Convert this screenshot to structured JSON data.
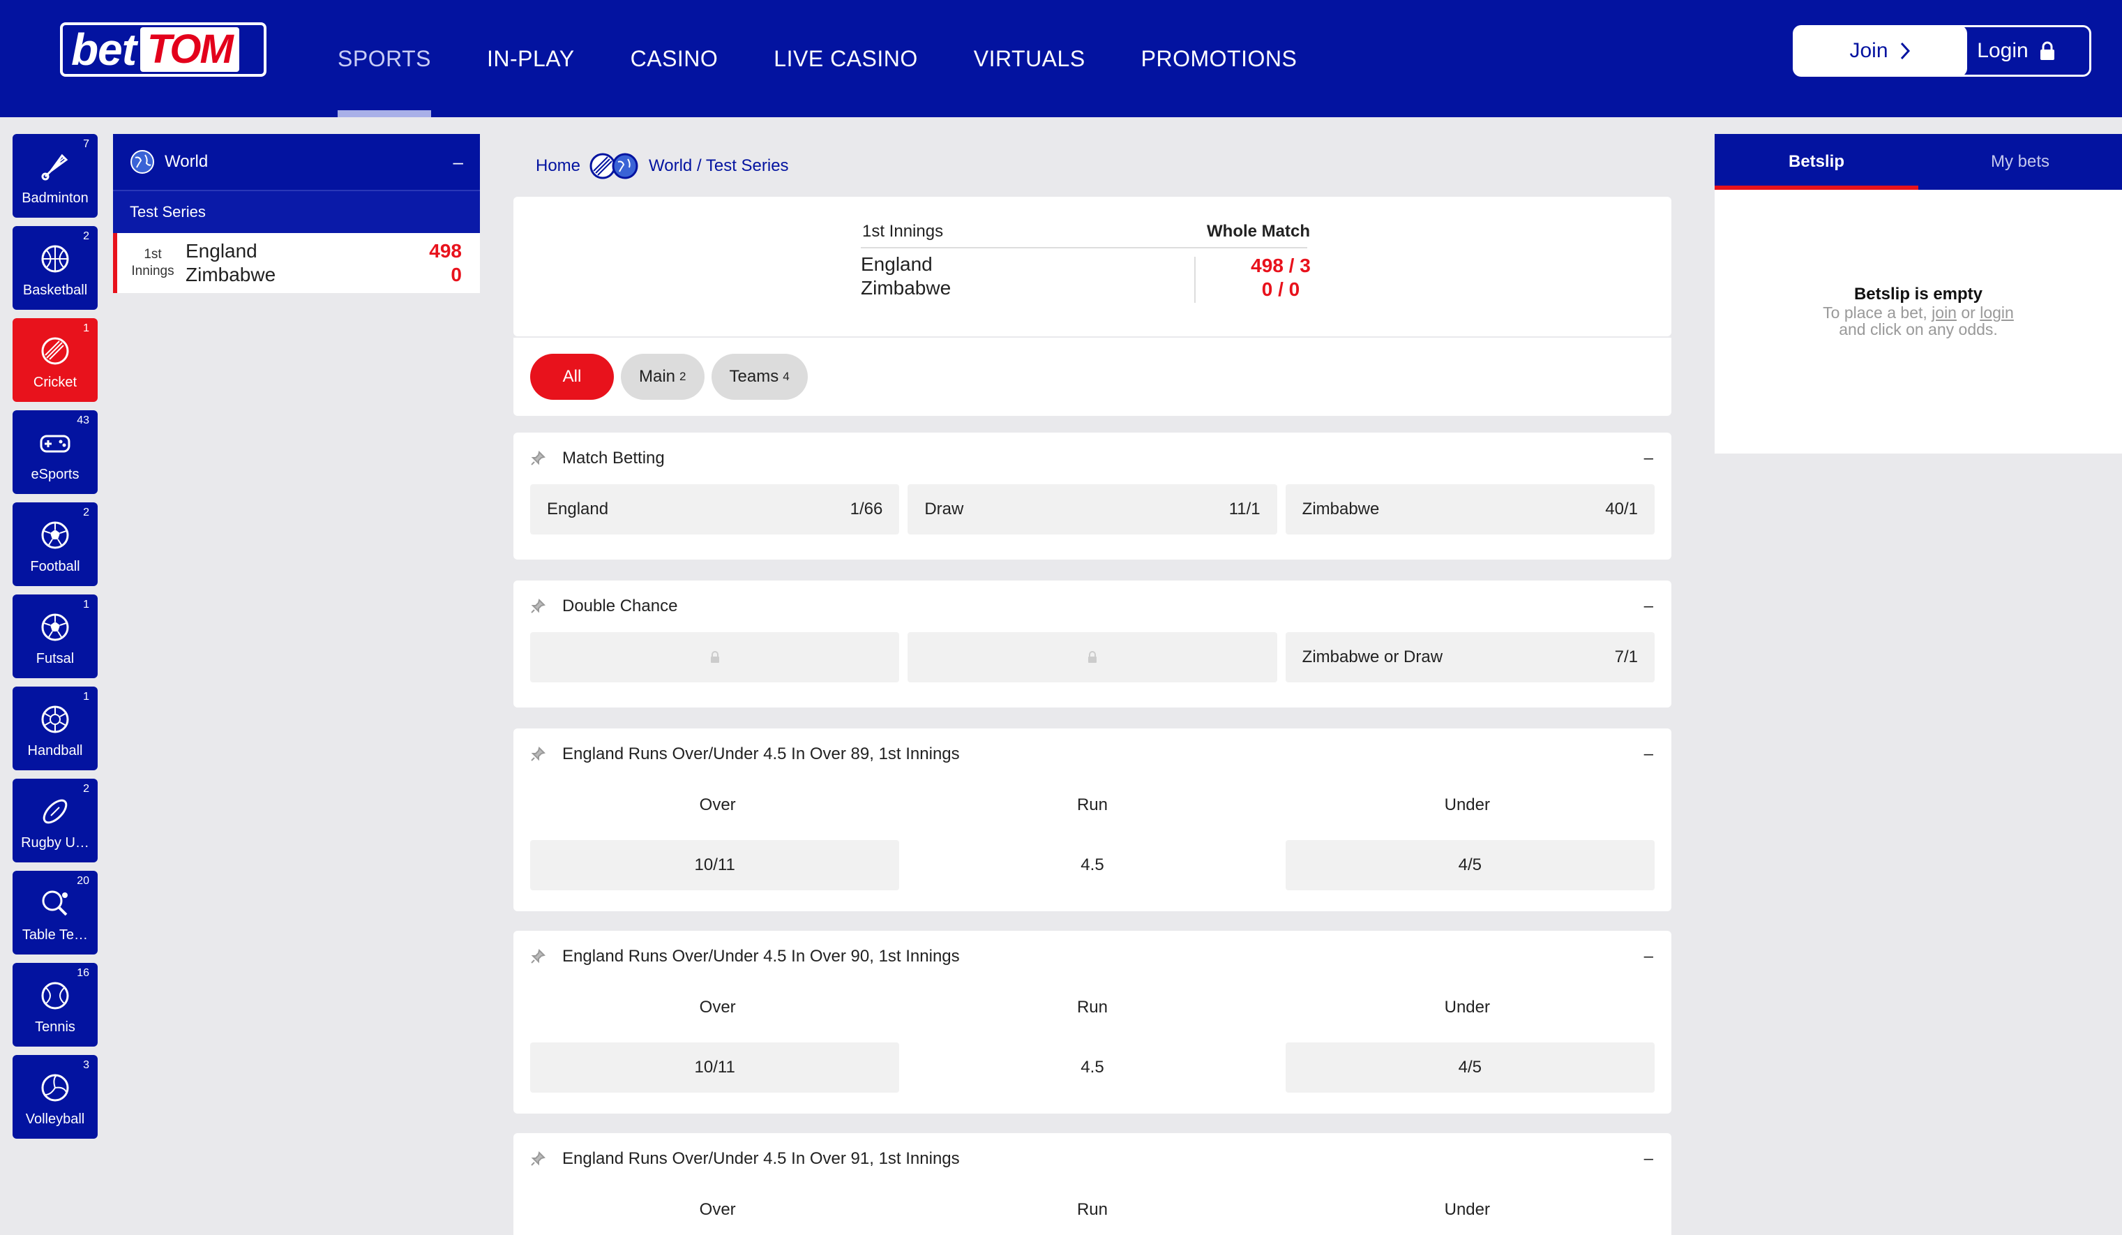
{
  "brand": {
    "logo_bet": "bet",
    "logo_tom": "TOM"
  },
  "nav": [
    "SPORTS",
    "IN-PLAY",
    "CASINO",
    "LIVE CASINO",
    "VIRTUALS",
    "PROMOTIONS"
  ],
  "auth": {
    "join": "Join",
    "login": "Login"
  },
  "sports": [
    {
      "label": "Badminton",
      "count": "7",
      "icon": "badminton-icon"
    },
    {
      "label": "Basketball",
      "count": "2",
      "icon": "basketball-icon"
    },
    {
      "label": "Cricket",
      "count": "1",
      "icon": "cricket-icon"
    },
    {
      "label": "eSports",
      "count": "43",
      "icon": "gamepad-icon"
    },
    {
      "label": "Football",
      "count": "2",
      "icon": "football-icon"
    },
    {
      "label": "Futsal",
      "count": "1",
      "icon": "futsal-icon"
    },
    {
      "label": "Handball",
      "count": "1",
      "icon": "handball-icon"
    },
    {
      "label": "Rugby U…",
      "count": "2",
      "icon": "rugby-icon"
    },
    {
      "label": "Table Te…",
      "count": "20",
      "icon": "table-tennis-icon"
    },
    {
      "label": "Tennis",
      "count": "16",
      "icon": "tennis-icon"
    },
    {
      "label": "Volleyball",
      "count": "3",
      "icon": "volleyball-icon"
    }
  ],
  "events_panel": {
    "region": "World",
    "toggle": "–",
    "competition": "Test Series",
    "event": {
      "period_1": "1st",
      "period_2": "Innings",
      "home": "England",
      "away": "Zimbabwe",
      "home_score": "498",
      "away_score": "0"
    }
  },
  "breadcrumb": {
    "home": "Home",
    "path": "World / Test Series"
  },
  "scoreboard": {
    "period": "1st Innings",
    "whole_match": "Whole Match",
    "home": "England",
    "away": "Zimbabwe",
    "home_score": "498 / 3",
    "away_score": "0 / 0"
  },
  "filters": [
    {
      "label": "All",
      "count": ""
    },
    {
      "label": "Main",
      "count": "2"
    },
    {
      "label": "Teams",
      "count": "4"
    }
  ],
  "markets": {
    "match_betting": {
      "title": "Match Betting",
      "toggle": "–",
      "selections": [
        {
          "name": "England",
          "odds": "1/66"
        },
        {
          "name": "Draw",
          "odds": "11/1"
        },
        {
          "name": "Zimbabwe",
          "odds": "40/1"
        }
      ]
    },
    "double_chance": {
      "title": "Double Chance",
      "toggle": "–",
      "selection": {
        "name": "Zimbabwe or Draw",
        "odds": "7/1"
      }
    },
    "ou": [
      {
        "title": "England Runs Over/Under 4.5 In Over 89, 1st Innings",
        "toggle": "–",
        "over_label": "Over",
        "run_label": "Run",
        "under_label": "Under",
        "over": "10/11",
        "line": "4.5",
        "under": "4/5"
      },
      {
        "title": "England Runs Over/Under 4.5 In Over 90, 1st Innings",
        "toggle": "–",
        "over_label": "Over",
        "run_label": "Run",
        "under_label": "Under",
        "over": "10/11",
        "line": "4.5",
        "under": "4/5"
      },
      {
        "title": "England Runs Over/Under 4.5 In Over 91, 1st Innings",
        "toggle": "–",
        "over_label": "Over",
        "run_label": "Run",
        "under_label": "Under"
      }
    ]
  },
  "betslip": {
    "tab_betslip": "Betslip",
    "tab_mybets": "My bets",
    "empty_title": "Betslip is empty",
    "msg_pre": "To place a bet,",
    "msg_join": "join",
    "msg_or": "or",
    "msg_login": "login",
    "msg_post": "and click on any odds."
  },
  "colors": {
    "brand_blue": "#0313a0",
    "accent_red": "#e8121c",
    "background": "#e9e9ec"
  }
}
